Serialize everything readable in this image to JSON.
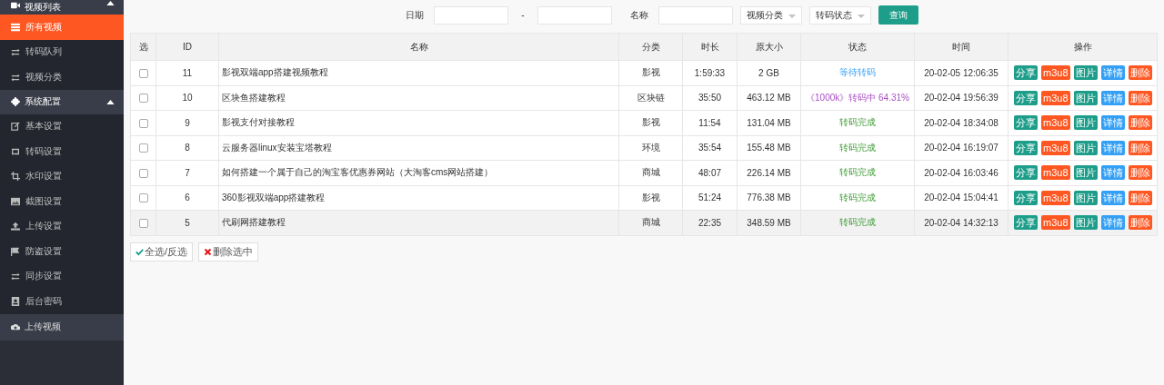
{
  "sidebar": {
    "groups": [
      {
        "label": "视频列表",
        "expanded": true,
        "items": [
          {
            "label": "所有视频",
            "selected": true
          },
          {
            "label": "转码队列",
            "selected": false
          },
          {
            "label": "视频分类",
            "selected": false
          }
        ]
      },
      {
        "label": "系统配置",
        "expanded": true,
        "items": [
          {
            "label": "基本设置",
            "selected": false
          },
          {
            "label": "转码设置",
            "selected": false
          },
          {
            "label": "水印设置",
            "selected": false
          },
          {
            "label": "截图设置",
            "selected": false
          },
          {
            "label": "上传设置",
            "selected": false
          },
          {
            "label": "防盗设置",
            "selected": false
          },
          {
            "label": "同步设置",
            "selected": false
          },
          {
            "label": "后台密码",
            "selected": false
          }
        ]
      },
      {
        "label": "上传视频"
      }
    ]
  },
  "filters": {
    "date_label": "日期",
    "date_separator": "-",
    "name_label": "名称",
    "category_select": "视频分类",
    "status_select": "转码状态",
    "search_button": "查询"
  },
  "table": {
    "columns": [
      "选",
      "ID",
      "名称",
      "分类",
      "时长",
      "原大小",
      "状态",
      "时间",
      "操作"
    ],
    "rows": [
      {
        "checked": false,
        "highlighted": false,
        "id": "11",
        "name": "影视双端app搭建视频教程",
        "category": "影视",
        "duration": "1:59:33",
        "size": "2 GB",
        "status": {
          "text": "等待转码",
          "kind": "waiting"
        },
        "time": "20-02-05 12:06:35",
        "actions": [
          {
            "label": "分享",
            "kind": "teal"
          },
          {
            "label": "m3u8",
            "kind": "orange"
          },
          {
            "label": "图片",
            "kind": "teal"
          },
          {
            "label": "详情",
            "kind": "blue"
          },
          {
            "label": "删除",
            "kind": "orange"
          }
        ]
      },
      {
        "checked": false,
        "highlighted": false,
        "id": "10",
        "name": "区块鱼搭建教程",
        "category": "区块链",
        "duration": "35:50",
        "size": "463.12 MB",
        "status": {
          "text": "《1000k》转码中 64.31%",
          "kind": "transcoding"
        },
        "time": "20-02-04 19:56:39",
        "actions": [
          {
            "label": "分享",
            "kind": "teal"
          },
          {
            "label": "m3u8",
            "kind": "orange"
          },
          {
            "label": "图片",
            "kind": "teal"
          },
          {
            "label": "详情",
            "kind": "blue"
          },
          {
            "label": "删除",
            "kind": "orange"
          }
        ]
      },
      {
        "checked": false,
        "highlighted": false,
        "id": "9",
        "name": "影视支付对接教程",
        "category": "影视",
        "duration": "11:54",
        "size": "131.04 MB",
        "status": {
          "text": "转码完成",
          "kind": "done"
        },
        "time": "20-02-04 18:34:08",
        "actions": [
          {
            "label": "分享",
            "kind": "teal"
          },
          {
            "label": "m3u8",
            "kind": "orange"
          },
          {
            "label": "图片",
            "kind": "teal"
          },
          {
            "label": "详情",
            "kind": "blue"
          },
          {
            "label": "删除",
            "kind": "orange"
          }
        ]
      },
      {
        "checked": false,
        "highlighted": false,
        "id": "8",
        "name": "云服务器linux安装宝塔教程",
        "category": "环境",
        "duration": "35:54",
        "size": "155.48 MB",
        "status": {
          "text": "转码完成",
          "kind": "done"
        },
        "time": "20-02-04 16:19:07",
        "actions": [
          {
            "label": "分享",
            "kind": "teal"
          },
          {
            "label": "m3u8",
            "kind": "orange"
          },
          {
            "label": "图片",
            "kind": "teal"
          },
          {
            "label": "详情",
            "kind": "blue"
          },
          {
            "label": "删除",
            "kind": "orange"
          }
        ]
      },
      {
        "checked": false,
        "highlighted": false,
        "id": "7",
        "name": "如何搭建一个属于自己的淘宝客优惠券网站（大淘客cms网站搭建）",
        "category": "商城",
        "duration": "48:07",
        "size": "226.14 MB",
        "status": {
          "text": "转码完成",
          "kind": "done"
        },
        "time": "20-02-04 16:03:46",
        "actions": [
          {
            "label": "分享",
            "kind": "teal"
          },
          {
            "label": "m3u8",
            "kind": "orange"
          },
          {
            "label": "图片",
            "kind": "teal"
          },
          {
            "label": "详情",
            "kind": "blue"
          },
          {
            "label": "删除",
            "kind": "orange"
          }
        ]
      },
      {
        "checked": false,
        "highlighted": false,
        "id": "6",
        "name": "360影视双端app搭建教程",
        "category": "影视",
        "duration": "51:24",
        "size": "776.38 MB",
        "status": {
          "text": "转码完成",
          "kind": "done"
        },
        "time": "20-02-04 15:04:41",
        "actions": [
          {
            "label": "分享",
            "kind": "teal"
          },
          {
            "label": "m3u8",
            "kind": "orange"
          },
          {
            "label": "图片",
            "kind": "teal"
          },
          {
            "label": "详情",
            "kind": "blue"
          },
          {
            "label": "删除",
            "kind": "orange"
          }
        ]
      },
      {
        "checked": false,
        "highlighted": true,
        "id": "5",
        "name": "代刷网搭建教程",
        "category": "商城",
        "duration": "22:35",
        "size": "348.59 MB",
        "status": {
          "text": "转码完成",
          "kind": "done"
        },
        "time": "20-02-04 14:32:13",
        "actions": [
          {
            "label": "分享",
            "kind": "teal"
          },
          {
            "label": "m3u8",
            "kind": "orange"
          },
          {
            "label": "图片",
            "kind": "teal"
          },
          {
            "label": "详情",
            "kind": "blue"
          },
          {
            "label": "删除",
            "kind": "orange"
          }
        ]
      }
    ]
  },
  "footer_buttons": [
    {
      "label": "全选/反选"
    },
    {
      "label": "删除选中"
    }
  ]
}
